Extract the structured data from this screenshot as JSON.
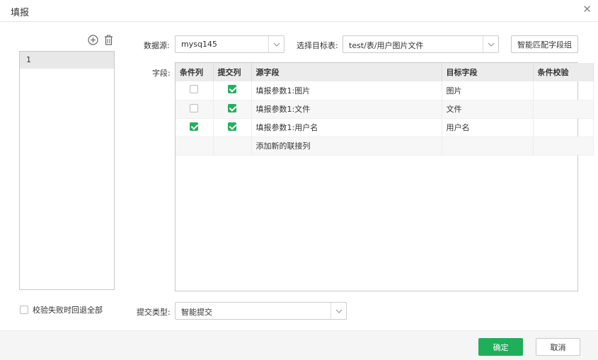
{
  "dialog": {
    "title": "填报"
  },
  "left": {
    "items": [
      "1"
    ],
    "rollback_label": "校验失败时回退全部",
    "rollback_checked": false
  },
  "datasource": {
    "label": "数据源:",
    "value": "mysq145"
  },
  "target": {
    "label": "选择目标表:",
    "value": "test/表/用户图片文件"
  },
  "smart_match_label": "智能匹配字段组",
  "fields": {
    "label": "字段:",
    "headers": [
      "条件列",
      "提交列",
      "源字段",
      "目标字段",
      "条件校验",
      ""
    ],
    "rows": [
      {
        "cond": false,
        "submit": true,
        "source": "填报参数1:图片",
        "target": "图片",
        "check": "",
        "del": "X"
      },
      {
        "cond": false,
        "submit": true,
        "source": "填报参数1:文件",
        "target": "文件",
        "check": "",
        "del": "X"
      },
      {
        "cond": true,
        "submit": true,
        "source": "填报参数1:用户名",
        "target": "用户名",
        "check": "",
        "del": "X"
      }
    ],
    "add_row_label": "添加新的联接列"
  },
  "submit_type": {
    "label": "提交类型:",
    "value": "智能提交"
  },
  "buttons": {
    "ok": "确定",
    "cancel": "取消"
  },
  "colors": {
    "accent": "#1fae5a"
  }
}
